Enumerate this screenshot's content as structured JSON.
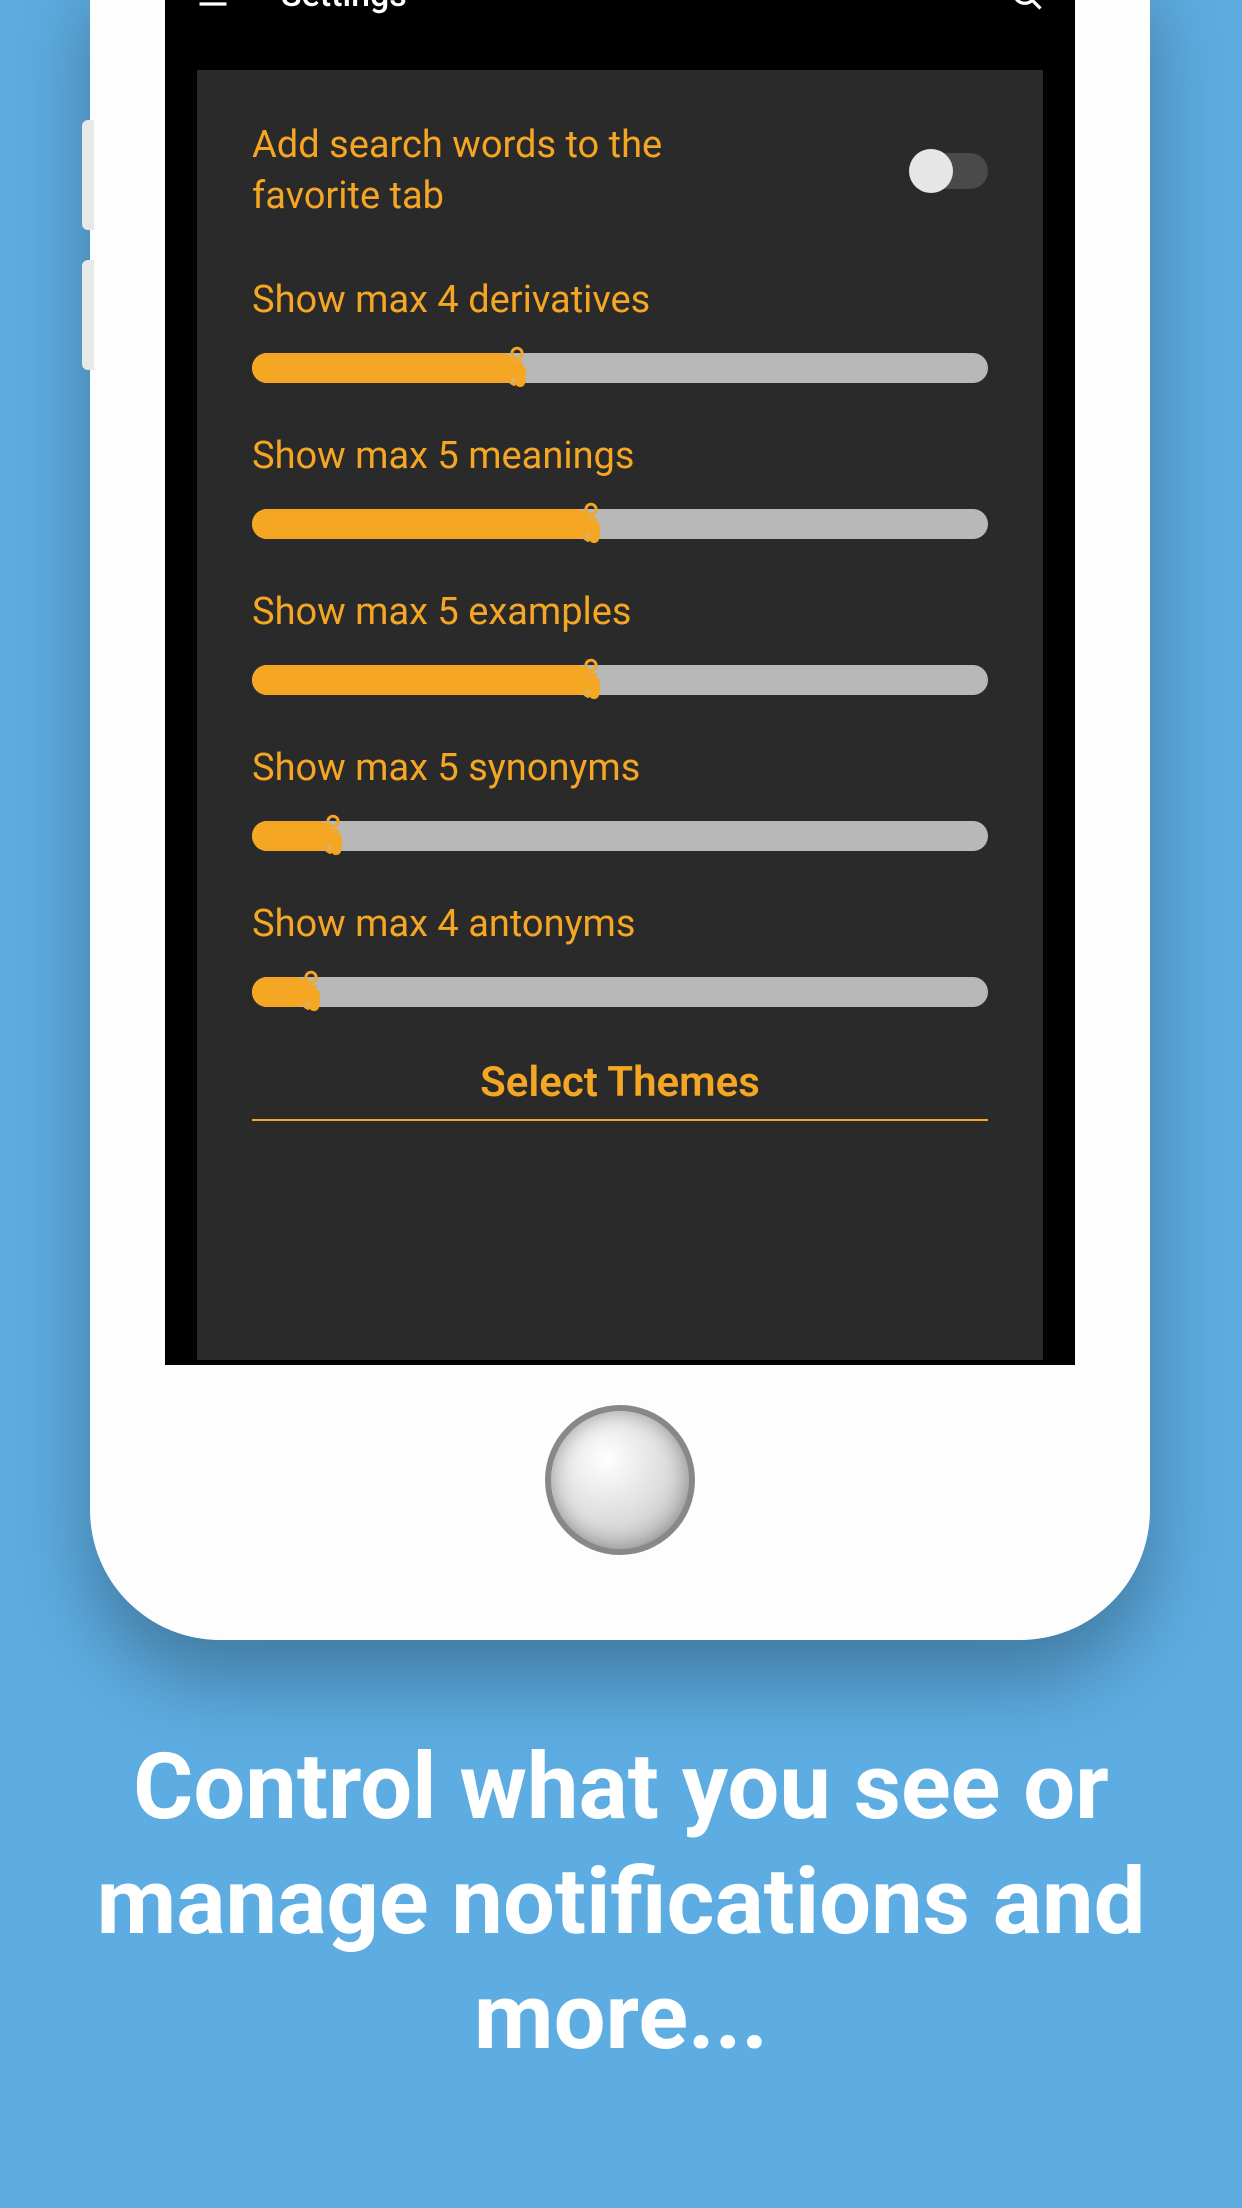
{
  "header": {
    "title": "Settings"
  },
  "settings": {
    "toggle": {
      "label": "Add search words to the favorite tab",
      "enabled": false
    },
    "sliders": [
      {
        "label": "Show max 4 derivatives",
        "fill_percent": 36
      },
      {
        "label": "Show max 5 meanings",
        "fill_percent": 46
      },
      {
        "label": "Show max 5 examples",
        "fill_percent": 46
      },
      {
        "label": "Show max 5 synonyms",
        "fill_percent": 11
      },
      {
        "label": "Show max 4 antonyms",
        "fill_percent": 8
      }
    ],
    "themes_button": "Select Themes"
  },
  "marketing": {
    "headline": "Control what you see or manage notifications and more..."
  },
  "colors": {
    "accent": "#f5a623",
    "background": "#5dade2",
    "panel": "#2a2a2a"
  }
}
